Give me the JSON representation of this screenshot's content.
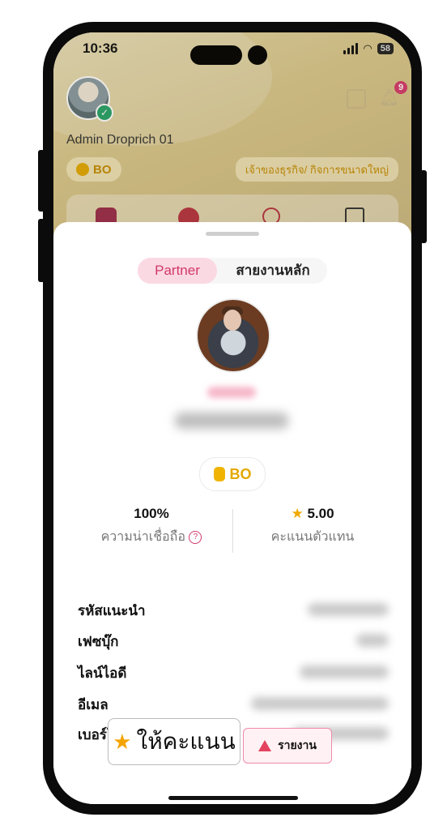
{
  "status_bar": {
    "time": "10:36",
    "battery": "58"
  },
  "header": {
    "admin_name": "Admin Droprich 01",
    "bo_label": "BO",
    "business_type": "เจ้าของธุรกิจ/ กิจการขนาดใหญ่",
    "notification_count": "9"
  },
  "sheet": {
    "tabs": [
      {
        "label": "Partner",
        "active": true
      },
      {
        "label": "สายงานหลัก",
        "active": false
      }
    ],
    "rank_badge": "BO",
    "stats": {
      "reliability_value": "100%",
      "reliability_label": "ความน่าเชื่อถือ",
      "rating_value": "5.00",
      "rating_label": "คะแนนตัวแทน"
    },
    "info_rows": [
      {
        "label": "รหัสแนะนำ"
      },
      {
        "label": "เฟซบุ๊ก"
      },
      {
        "label": "ไลน์ไอดี"
      },
      {
        "label": "อีเมล"
      },
      {
        "label": "เบอร์โทรศัพท์"
      }
    ],
    "rate_button": "ให้คะแนน",
    "report_button": "รายงาน"
  },
  "colors": {
    "accent": "#d2386a",
    "gold": "#e3a800",
    "header_bg": "#d9c68a"
  }
}
